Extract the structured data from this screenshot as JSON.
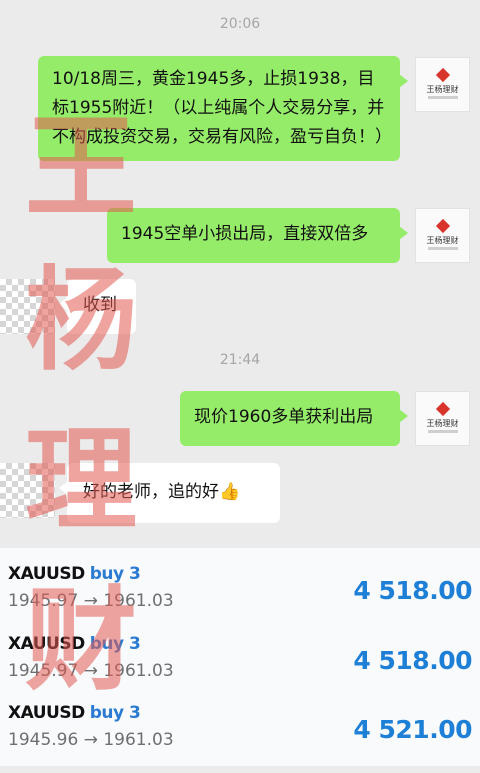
{
  "chat": {
    "timestamps": [
      "20:06",
      "21:44"
    ],
    "messages": [
      {
        "side": "out",
        "text": "10/18周三，黄金1945多，止损1938，目标1955附近！（以上纯属个人交易分享，并不构成投资交易，交易有风险，盈亏自负！）"
      },
      {
        "side": "out",
        "text": "1945空单小损出局，直接双倍多"
      },
      {
        "side": "in",
        "text": "收到"
      },
      {
        "side": "out",
        "text": "现价1960多单获利出局"
      },
      {
        "side": "in",
        "text": "好的老师，追的好",
        "emoji": "👍"
      }
    ],
    "avatar_brand": "王杨理财",
    "watermark": [
      "王",
      "杨",
      "理",
      "财"
    ]
  },
  "trades": [
    {
      "symbol": "XAUUSD",
      "direction": "buy 3",
      "prices": "1945.97 → 1961.03",
      "profit": "4 518.00"
    },
    {
      "symbol": "XAUUSD",
      "direction": "buy 3",
      "prices": "1945.97 → 1961.03",
      "profit": "4 518.00"
    },
    {
      "symbol": "XAUUSD",
      "direction": "buy 3",
      "prices": "1945.96 → 1961.03",
      "profit": "4 521.00"
    }
  ],
  "colors": {
    "outgoing_bubble": "#95ec69",
    "incoming_bubble": "#ffffff",
    "profit": "#1e7fd6",
    "direction": "#2b7bd2",
    "watermark": "#e25a52"
  }
}
